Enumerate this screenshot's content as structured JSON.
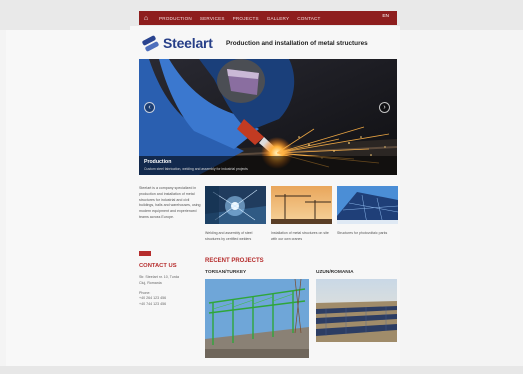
{
  "nav": {
    "items": [
      "PRODUCTION",
      "SERVICES",
      "PROJECTS",
      "GALLERY",
      "CONTACT"
    ],
    "lang": "EN"
  },
  "brand": {
    "name": "Steelart",
    "tagline": "Production and installation of metal structures"
  },
  "slider": {
    "caption_title": "Production",
    "caption_sub": "Custom steel fabrication, welding and assembly for industrial projects"
  },
  "intro": {
    "text": "Steelart is a company specialized in production and installation of metal structures for industrial and civil buildings, halls and warehouses, using modern equipment and experienced teams across Europe."
  },
  "contact": {
    "title": "CONTACT US",
    "lines": [
      "Str. Steelart nr. 10, Turda",
      "Cluj, Romania",
      "Phone:",
      "+40 264 123 456",
      "+40 744 123 456"
    ]
  },
  "thumbs": [
    {
      "caption": "Welding and assembly of steel structures by certified welders"
    },
    {
      "caption": "Installation of metal structures on site with our own cranes"
    },
    {
      "caption": "Structures for photovoltaic parks"
    }
  ],
  "projects": {
    "title": "RECENT PROJECTS",
    "items": [
      {
        "name": "TORSAN/TURKEY"
      },
      {
        "name": "UZUN/ROMANIA"
      }
    ]
  },
  "colors": {
    "nav_red": "#8e1e1e",
    "accent_red": "#b62d2d",
    "brand_blue": "#273f88"
  }
}
